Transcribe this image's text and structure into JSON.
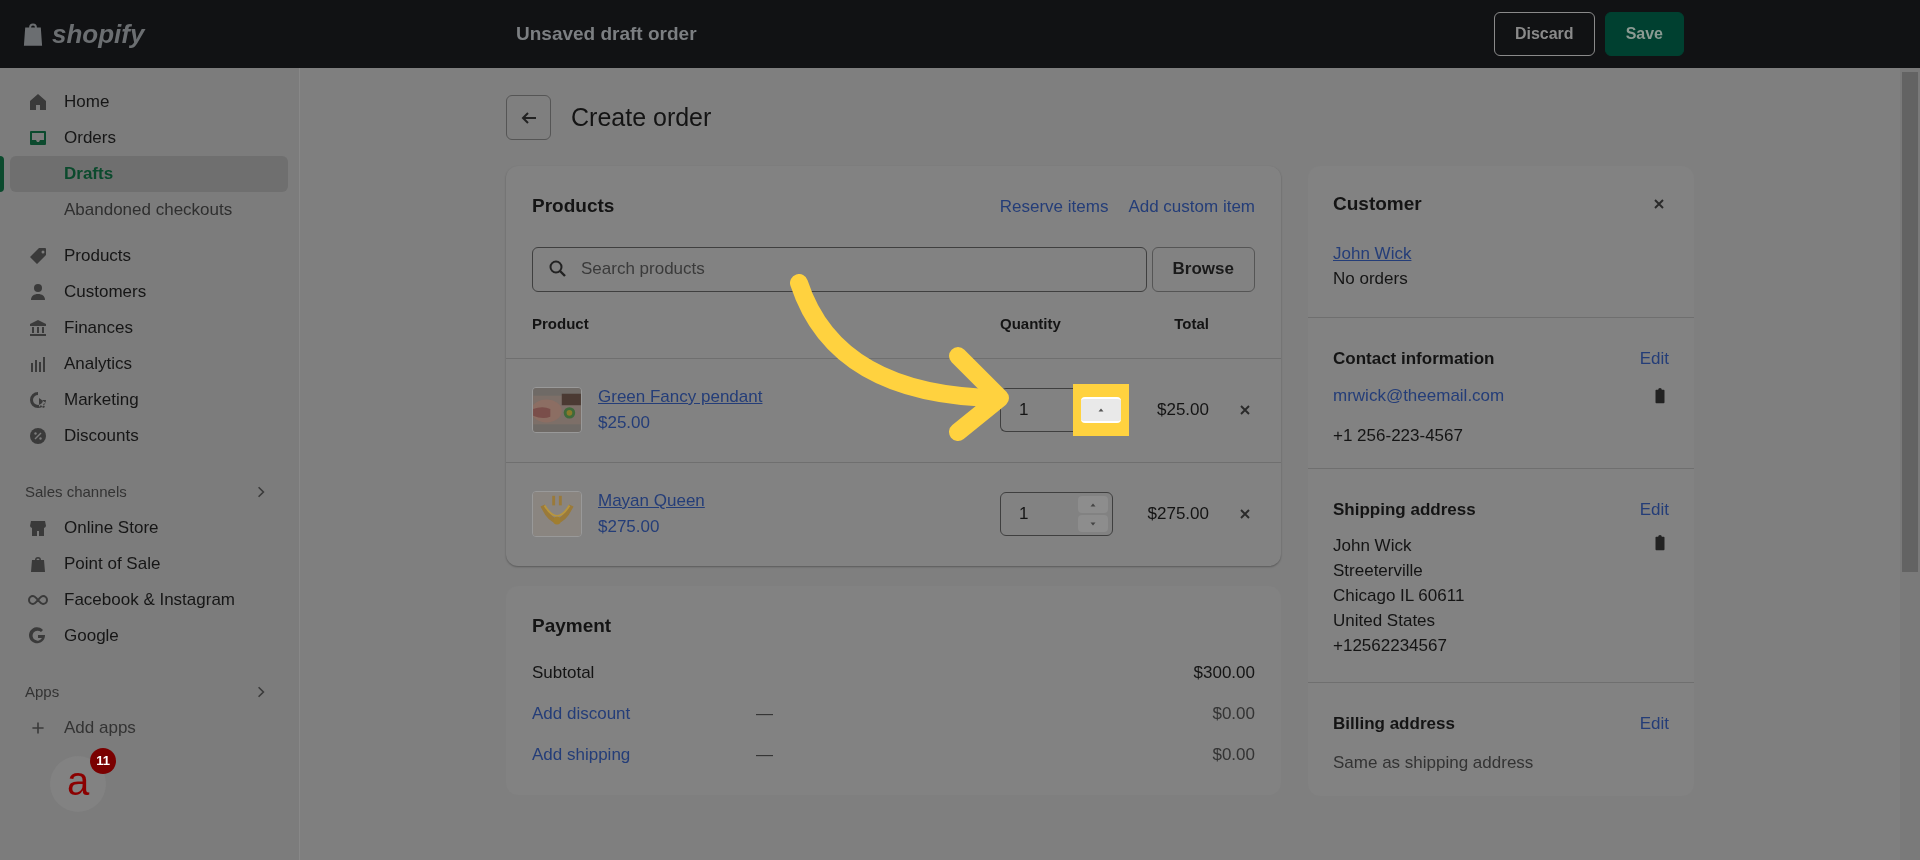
{
  "topbar": {
    "brand": "shopify",
    "title": "Unsaved draft order",
    "buttons": [
      {
        "label": "Discard",
        "kind": "secondary"
      },
      {
        "label": "Save",
        "kind": "primary"
      }
    ]
  },
  "sidebar": {
    "items": [
      {
        "label": "Home",
        "kind": "main",
        "selected": false
      },
      {
        "label": "Orders",
        "kind": "main",
        "selected": false
      },
      {
        "label": "Drafts",
        "kind": "sub",
        "selected": true
      },
      {
        "label": "Abandoned checkouts",
        "kind": "sub",
        "selected": false
      },
      {
        "label": "Products",
        "kind": "main",
        "selected": false
      },
      {
        "label": "Customers",
        "kind": "main",
        "selected": false
      },
      {
        "label": "Finances",
        "kind": "main",
        "selected": false
      },
      {
        "label": "Analytics",
        "kind": "main",
        "selected": false
      },
      {
        "label": "Marketing",
        "kind": "main",
        "selected": false
      },
      {
        "label": "Discounts",
        "kind": "main",
        "selected": false
      }
    ],
    "sections": [
      {
        "title": "Sales channels",
        "items": [
          {
            "label": "Online Store",
            "kind": "main",
            "selected": false
          },
          {
            "label": "Point of Sale",
            "kind": "main",
            "selected": false
          },
          {
            "label": "Facebook & Instagram",
            "kind": "main",
            "selected": false
          },
          {
            "label": "Google",
            "kind": "main",
            "selected": false
          }
        ]
      },
      {
        "title": "Apps",
        "items": [
          {
            "label": "Add apps",
            "kind": "add",
            "selected": false
          }
        ]
      }
    ],
    "avatar": {
      "letter": "a",
      "badge": "11"
    }
  },
  "page": {
    "title": "Create order"
  },
  "products": {
    "title": "Products",
    "links": [
      "Reserve items",
      "Add custom item"
    ],
    "search": {
      "placeholder": "Search products"
    },
    "browse": "Browse",
    "columns": [
      "Product",
      "Quantity",
      "Total"
    ],
    "rows": [
      {
        "name": "Green Fancy pendant",
        "price": "$25.00",
        "quantity": "1",
        "total": "$25.00",
        "highlighted": true
      },
      {
        "name": "Mayan Queen",
        "price": "$275.00",
        "quantity": "1",
        "total": "$275.00",
        "highlighted": false
      }
    ]
  },
  "payment": {
    "title": "Payment",
    "rows": [
      {
        "label": "Subtotal",
        "kind": "text",
        "note": null,
        "amount": "$300.00"
      },
      {
        "label": "Add discount",
        "kind": "link",
        "note": "—",
        "amount": "$0.00"
      },
      {
        "label": "Add shipping",
        "kind": "link",
        "note": "—",
        "amount": "$0.00"
      }
    ]
  },
  "customer": {
    "title": "Customer",
    "name": "John Wick",
    "orders": "No orders",
    "contact": {
      "title": "Contact information",
      "edit": "Edit",
      "email": "mrwick@theemail.com",
      "phone": "+1 256-223-4567"
    },
    "shipping": {
      "title": "Shipping address",
      "edit": "Edit",
      "lines": [
        "John Wick",
        "Streeterville",
        "Chicago IL 60611",
        "United States",
        "+12562234567"
      ]
    },
    "billing": {
      "title": "Billing address",
      "edit": "Edit",
      "note": "Same as shipping address"
    }
  }
}
